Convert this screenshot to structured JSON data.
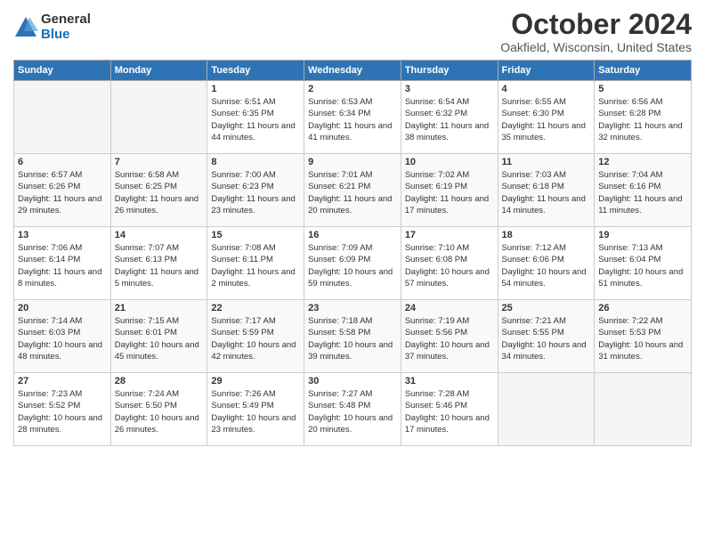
{
  "header": {
    "logo_general": "General",
    "logo_blue": "Blue",
    "month_title": "October 2024",
    "location": "Oakfield, Wisconsin, United States"
  },
  "weekdays": [
    "Sunday",
    "Monday",
    "Tuesday",
    "Wednesday",
    "Thursday",
    "Friday",
    "Saturday"
  ],
  "weeks": [
    [
      {
        "day": "",
        "sunrise": "",
        "sunset": "",
        "daylight": "",
        "empty": true
      },
      {
        "day": "",
        "sunrise": "",
        "sunset": "",
        "daylight": "",
        "empty": true
      },
      {
        "day": "1",
        "sunrise": "Sunrise: 6:51 AM",
        "sunset": "Sunset: 6:35 PM",
        "daylight": "Daylight: 11 hours and 44 minutes."
      },
      {
        "day": "2",
        "sunrise": "Sunrise: 6:53 AM",
        "sunset": "Sunset: 6:34 PM",
        "daylight": "Daylight: 11 hours and 41 minutes."
      },
      {
        "day": "3",
        "sunrise": "Sunrise: 6:54 AM",
        "sunset": "Sunset: 6:32 PM",
        "daylight": "Daylight: 11 hours and 38 minutes."
      },
      {
        "day": "4",
        "sunrise": "Sunrise: 6:55 AM",
        "sunset": "Sunset: 6:30 PM",
        "daylight": "Daylight: 11 hours and 35 minutes."
      },
      {
        "day": "5",
        "sunrise": "Sunrise: 6:56 AM",
        "sunset": "Sunset: 6:28 PM",
        "daylight": "Daylight: 11 hours and 32 minutes."
      }
    ],
    [
      {
        "day": "6",
        "sunrise": "Sunrise: 6:57 AM",
        "sunset": "Sunset: 6:26 PM",
        "daylight": "Daylight: 11 hours and 29 minutes."
      },
      {
        "day": "7",
        "sunrise": "Sunrise: 6:58 AM",
        "sunset": "Sunset: 6:25 PM",
        "daylight": "Daylight: 11 hours and 26 minutes."
      },
      {
        "day": "8",
        "sunrise": "Sunrise: 7:00 AM",
        "sunset": "Sunset: 6:23 PM",
        "daylight": "Daylight: 11 hours and 23 minutes."
      },
      {
        "day": "9",
        "sunrise": "Sunrise: 7:01 AM",
        "sunset": "Sunset: 6:21 PM",
        "daylight": "Daylight: 11 hours and 20 minutes."
      },
      {
        "day": "10",
        "sunrise": "Sunrise: 7:02 AM",
        "sunset": "Sunset: 6:19 PM",
        "daylight": "Daylight: 11 hours and 17 minutes."
      },
      {
        "day": "11",
        "sunrise": "Sunrise: 7:03 AM",
        "sunset": "Sunset: 6:18 PM",
        "daylight": "Daylight: 11 hours and 14 minutes."
      },
      {
        "day": "12",
        "sunrise": "Sunrise: 7:04 AM",
        "sunset": "Sunset: 6:16 PM",
        "daylight": "Daylight: 11 hours and 11 minutes."
      }
    ],
    [
      {
        "day": "13",
        "sunrise": "Sunrise: 7:06 AM",
        "sunset": "Sunset: 6:14 PM",
        "daylight": "Daylight: 11 hours and 8 minutes."
      },
      {
        "day": "14",
        "sunrise": "Sunrise: 7:07 AM",
        "sunset": "Sunset: 6:13 PM",
        "daylight": "Daylight: 11 hours and 5 minutes."
      },
      {
        "day": "15",
        "sunrise": "Sunrise: 7:08 AM",
        "sunset": "Sunset: 6:11 PM",
        "daylight": "Daylight: 11 hours and 2 minutes."
      },
      {
        "day": "16",
        "sunrise": "Sunrise: 7:09 AM",
        "sunset": "Sunset: 6:09 PM",
        "daylight": "Daylight: 10 hours and 59 minutes."
      },
      {
        "day": "17",
        "sunrise": "Sunrise: 7:10 AM",
        "sunset": "Sunset: 6:08 PM",
        "daylight": "Daylight: 10 hours and 57 minutes."
      },
      {
        "day": "18",
        "sunrise": "Sunrise: 7:12 AM",
        "sunset": "Sunset: 6:06 PM",
        "daylight": "Daylight: 10 hours and 54 minutes."
      },
      {
        "day": "19",
        "sunrise": "Sunrise: 7:13 AM",
        "sunset": "Sunset: 6:04 PM",
        "daylight": "Daylight: 10 hours and 51 minutes."
      }
    ],
    [
      {
        "day": "20",
        "sunrise": "Sunrise: 7:14 AM",
        "sunset": "Sunset: 6:03 PM",
        "daylight": "Daylight: 10 hours and 48 minutes."
      },
      {
        "day": "21",
        "sunrise": "Sunrise: 7:15 AM",
        "sunset": "Sunset: 6:01 PM",
        "daylight": "Daylight: 10 hours and 45 minutes."
      },
      {
        "day": "22",
        "sunrise": "Sunrise: 7:17 AM",
        "sunset": "Sunset: 5:59 PM",
        "daylight": "Daylight: 10 hours and 42 minutes."
      },
      {
        "day": "23",
        "sunrise": "Sunrise: 7:18 AM",
        "sunset": "Sunset: 5:58 PM",
        "daylight": "Daylight: 10 hours and 39 minutes."
      },
      {
        "day": "24",
        "sunrise": "Sunrise: 7:19 AM",
        "sunset": "Sunset: 5:56 PM",
        "daylight": "Daylight: 10 hours and 37 minutes."
      },
      {
        "day": "25",
        "sunrise": "Sunrise: 7:21 AM",
        "sunset": "Sunset: 5:55 PM",
        "daylight": "Daylight: 10 hours and 34 minutes."
      },
      {
        "day": "26",
        "sunrise": "Sunrise: 7:22 AM",
        "sunset": "Sunset: 5:53 PM",
        "daylight": "Daylight: 10 hours and 31 minutes."
      }
    ],
    [
      {
        "day": "27",
        "sunrise": "Sunrise: 7:23 AM",
        "sunset": "Sunset: 5:52 PM",
        "daylight": "Daylight: 10 hours and 28 minutes."
      },
      {
        "day": "28",
        "sunrise": "Sunrise: 7:24 AM",
        "sunset": "Sunset: 5:50 PM",
        "daylight": "Daylight: 10 hours and 26 minutes."
      },
      {
        "day": "29",
        "sunrise": "Sunrise: 7:26 AM",
        "sunset": "Sunset: 5:49 PM",
        "daylight": "Daylight: 10 hours and 23 minutes."
      },
      {
        "day": "30",
        "sunrise": "Sunrise: 7:27 AM",
        "sunset": "Sunset: 5:48 PM",
        "daylight": "Daylight: 10 hours and 20 minutes."
      },
      {
        "day": "31",
        "sunrise": "Sunrise: 7:28 AM",
        "sunset": "Sunset: 5:46 PM",
        "daylight": "Daylight: 10 hours and 17 minutes."
      },
      {
        "day": "",
        "sunrise": "",
        "sunset": "",
        "daylight": "",
        "empty": true
      },
      {
        "day": "",
        "sunrise": "",
        "sunset": "",
        "daylight": "",
        "empty": true
      }
    ]
  ]
}
